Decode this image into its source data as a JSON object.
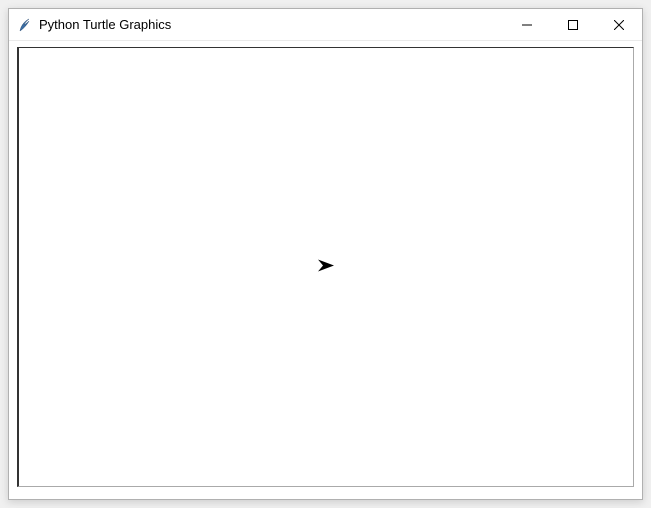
{
  "window": {
    "title": "Python Turtle Graphics",
    "icon": "feather-icon"
  },
  "controls": {
    "minimize": "minimize-icon",
    "maximize": "maximize-icon",
    "close": "close-icon"
  },
  "canvas": {
    "turtle": {
      "shape": "classic",
      "heading": 0,
      "position_x": 0,
      "position_y": 0,
      "color": "#000000"
    },
    "background_color": "#ffffff"
  }
}
